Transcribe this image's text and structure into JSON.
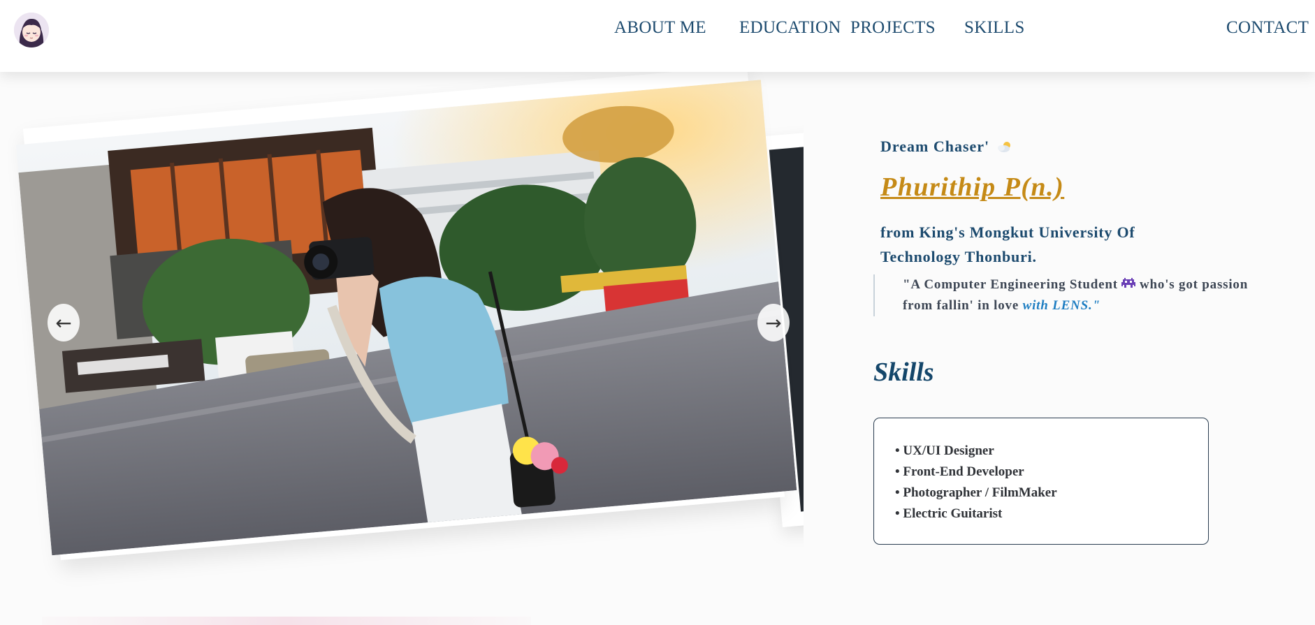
{
  "header": {
    "avatar": "avatar-illustration",
    "nav": [
      {
        "label": "ABOUT ME"
      },
      {
        "label": "EDUCATION"
      },
      {
        "label": "PROJECTS"
      },
      {
        "label": "SKILLS"
      },
      {
        "label": "CONTACT"
      }
    ]
  },
  "carousel": {
    "prev_icon": "←",
    "next_icon": "→",
    "photo": "photographer-holding-camera-street-photo"
  },
  "intro": {
    "tagline": "Dream Chaser'",
    "tagline_icon": "sun-behind-cloud-icon",
    "name": "Phurithip P(n.)",
    "university": "from King's Mongkut University Of Technology Thonburi.",
    "quote_part1": "\"A Computer Engineering Student",
    "quote_icon": "alien-monster-icon",
    "quote_part2": "who's got passion from fallin' in love",
    "quote_emphasis": "with LENS.\""
  },
  "skills": {
    "heading": "Skills",
    "items": [
      "UX/UI Designer",
      "Front-End Developer",
      "Photographer / FilmMaker",
      "Electric Guitarist"
    ]
  },
  "colors": {
    "nav_text": "#1c4a6e",
    "name_accent": "#c58a16",
    "quote_emphasis": "#1f7ec2"
  }
}
